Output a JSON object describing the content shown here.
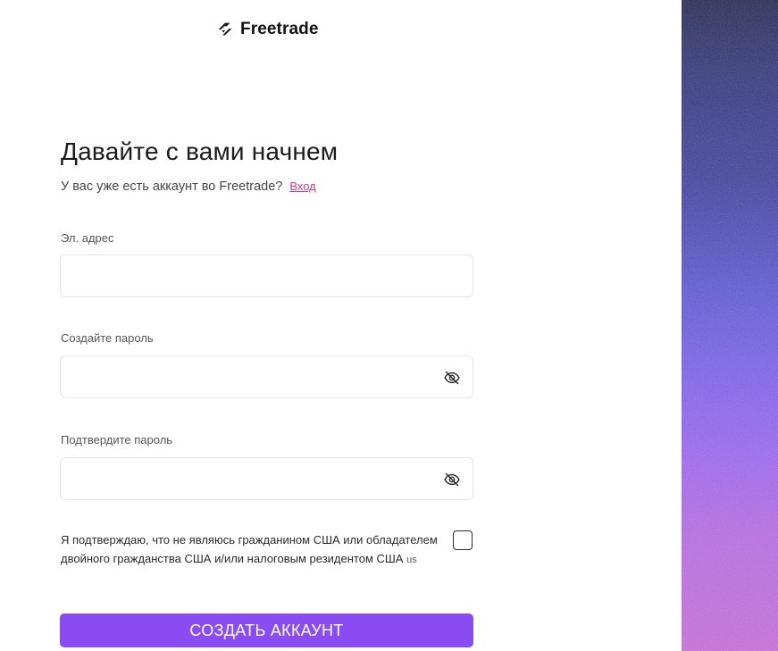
{
  "brand": {
    "name": "Freetrade",
    "logo_icon": "freetrade-logo-icon"
  },
  "heading": {
    "title": "Давайте с вами начнем",
    "subtitle": "У вас уже есть аккаунт во Freetrade?",
    "login_link": "Вход"
  },
  "form": {
    "email": {
      "label": "Эл. адрес",
      "value": "",
      "placeholder": ""
    },
    "password": {
      "label": "Создайте пароль",
      "value": "",
      "placeholder": "",
      "toggle_icon": "eye-off-icon"
    },
    "confirm_password": {
      "label": "Подтвердите пароль",
      "value": "",
      "placeholder": "",
      "toggle_icon": "eye-off-icon"
    },
    "consent": {
      "text": "Я подтверждаю, что не являюсь гражданином США или обладателем двойного гражданства США и/или налоговым резидентом США",
      "suffix": "us",
      "checked": false
    },
    "submit_label": "СОЗДАТЬ АККАУНТ"
  },
  "colors": {
    "accent": "#8a4bf3",
    "link": "#d63384",
    "art_top": "#26264e",
    "art_bottom": "#c06ad2"
  }
}
